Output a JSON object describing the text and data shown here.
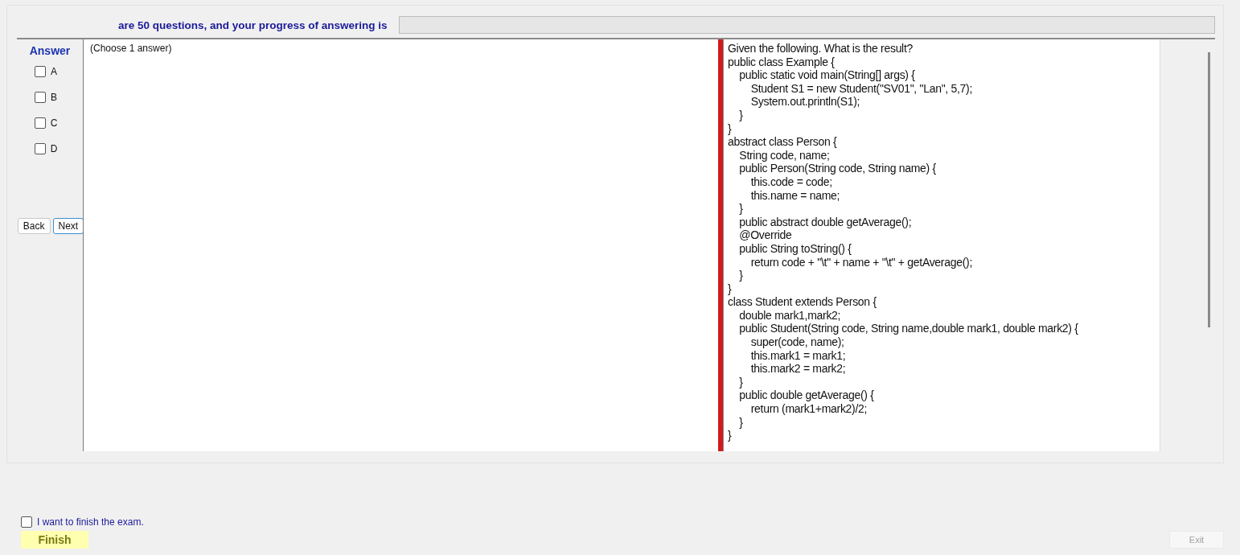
{
  "header": {
    "text": "are 50 questions, and your progress of answering is",
    "progress": {
      "level": 0
    }
  },
  "answer_panel": {
    "title": "Answer",
    "options": [
      {
        "label": "A",
        "checked": false
      },
      {
        "label": "B",
        "checked": false
      },
      {
        "label": "C",
        "checked": false
      },
      {
        "label": "D",
        "checked": false
      }
    ],
    "buttons": [
      {
        "label": "Back",
        "focused": false
      },
      {
        "label": "Next",
        "focused": true
      }
    ]
  },
  "instruction": "(Choose 1 answer)",
  "question_lines": [
    "Given the following. What is the result?",
    "public class Example {",
    "    public static void main(String[] args) {",
    "        Student S1 = new Student(\"SV01\", \"Lan\", 5,7);",
    "        System.out.println(S1);",
    "    }",
    "}",
    "abstract class Person {",
    "    String code, name;",
    "    public Person(String code, String name) {",
    "        this.code = code;",
    "        this.name = name;",
    "    }",
    "    public abstract double getAverage();",
    "    @Override",
    "    public String toString() {",
    "        return code + \"\\t\" + name + \"\\t\" + getAverage();",
    "    }",
    "}",
    "class Student extends Person {",
    "    double mark1,mark2;",
    "    public Student(String code, String name,double mark1, double mark2) {",
    "        super(code, name);",
    "        this.mark1 = mark1;",
    "        this.mark2 = mark2;",
    "    }",
    "    public double getAverage() {",
    "        return (mark1+mark2)/2;",
    "    }",
    "}"
  ],
  "finish": {
    "confirm_label": "I want to finish the exam.",
    "confirm_checked": false,
    "finish_button": "Finish",
    "exit_button": {
      "label": "Exit",
      "disabled": true
    }
  }
}
